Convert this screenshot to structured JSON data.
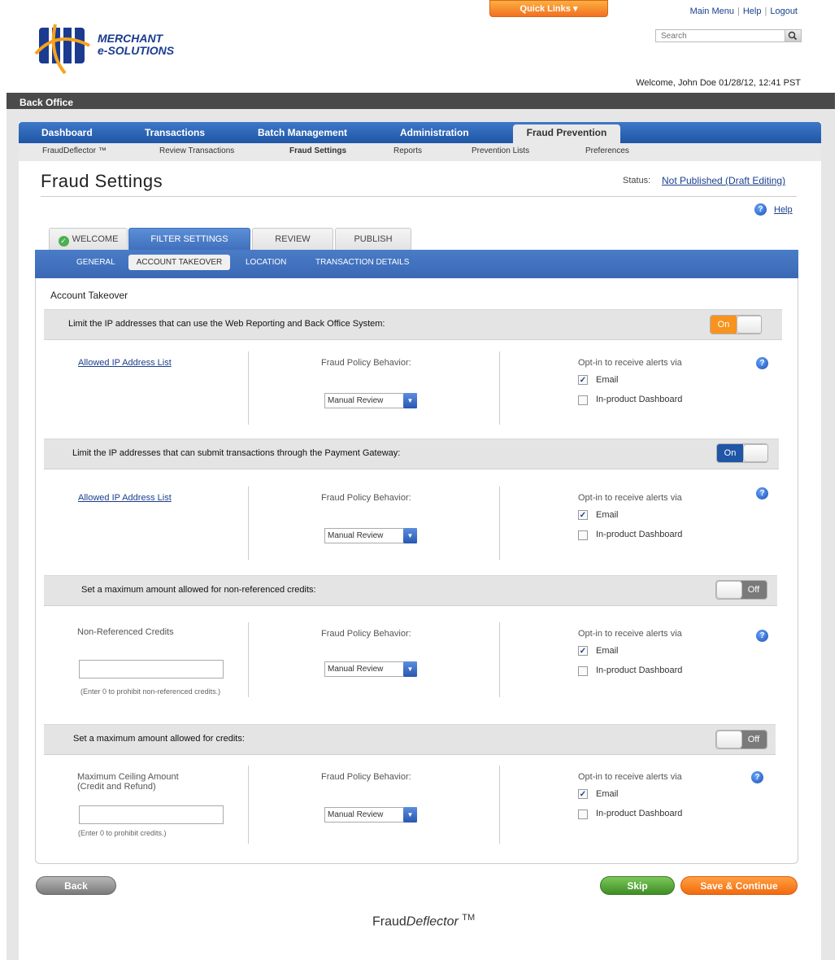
{
  "header": {
    "quick_links": "Quick Links ▾",
    "main_menu": "Main Menu",
    "help": "Help",
    "logout": "Logout",
    "search_placeholder": "Search",
    "logo_line1": "MERCHANT",
    "logo_line2": "e-SOLUTIONS",
    "welcome": "Welcome, John Doe 01/28/12, 12:41 PST"
  },
  "app_bar": "Back Office",
  "main_nav": [
    "Dashboard",
    "Transactions",
    "Batch Management",
    "Administration",
    "Fraud Prevention"
  ],
  "sub_nav": [
    "FraudDeflector ™",
    "Review Transactions",
    "Fraud Settings",
    "Reports",
    "Prevention Lists",
    "Preferences"
  ],
  "page": {
    "title": "Fraud Settings",
    "status_label": "Status:",
    "status_value": "Not Published (Draft Editing)",
    "help": "Help"
  },
  "wizard_tabs": [
    "WELCOME",
    "FILTER SETTINGS",
    "REVIEW",
    "PUBLISH"
  ],
  "filter_tabs": [
    "GENERAL",
    "ACCOUNT TAKEOVER",
    "LOCATION",
    "TRANSACTION DETAILS"
  ],
  "section_title": "Account Takeover",
  "common": {
    "policy_label": "Fraud Policy Behavior:",
    "policy_value": "Manual Review",
    "optin_label": "Opt-in to receive alerts via",
    "email": "Email",
    "dashboard": "In-product Dashboard",
    "allowed_ip": "Allowed IP Address List"
  },
  "rules": [
    {
      "label": "Limit the IP addresses that can use the Web Reporting and Back Office System:",
      "toggle": "On",
      "toggle_color": "#f7931e"
    },
    {
      "label": "Limit the IP addresses that can submit transactions through the Payment Gateway:",
      "toggle": "On",
      "toggle_color": "#1f56a6"
    },
    {
      "label": "Set a maximum amount allowed for non-referenced credits:",
      "toggle": "Off",
      "field_label": "Non-Referenced Credits",
      "hint": "(Enter 0 to prohibit non-referenced credits.)"
    },
    {
      "label": "Set a maximum amount allowed for credits:",
      "toggle": "Off",
      "field_label": "Maximum Ceiling Amount (Credit and Refund)",
      "hint": "(Enter 0 to prohibit credits.)"
    }
  ],
  "buttons": {
    "back": "Back",
    "skip": "Skip",
    "save": "Save & Continue"
  },
  "footer": {
    "brand1": "Fraud",
    "brand2": "Deflector",
    "tm": "TM"
  }
}
